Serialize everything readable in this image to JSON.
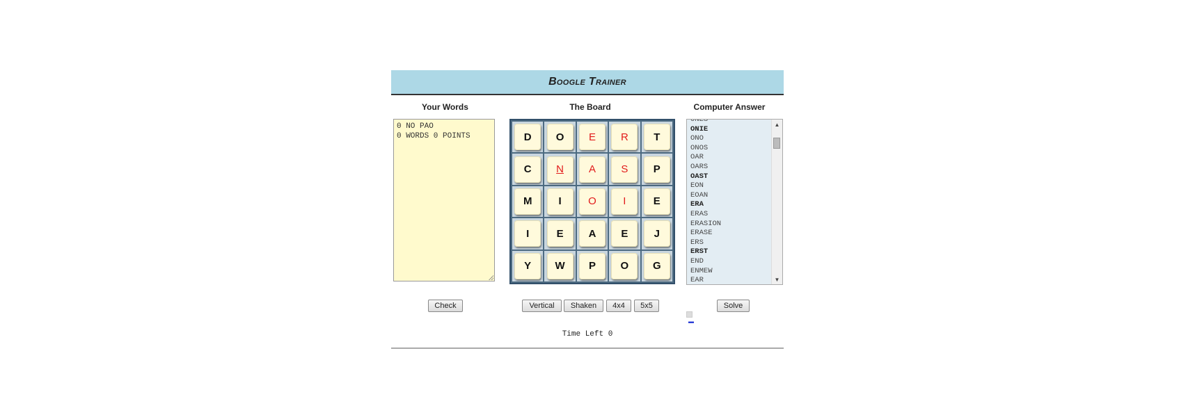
{
  "header": {
    "title": "Boogle Trainer"
  },
  "columns": {
    "your_words": "Your Words",
    "board": "The Board",
    "computer": "Computer Answer"
  },
  "your_words": {
    "lines": [
      "0 NO PAO",
      "0 WORDS 0 POINTS"
    ]
  },
  "board": {
    "size": 5,
    "rows": [
      [
        "D",
        "O",
        "E",
        "R",
        "T"
      ],
      [
        "C",
        "N",
        "A",
        "S",
        "P"
      ],
      [
        "M",
        "I",
        "O",
        "I",
        "E"
      ],
      [
        "I",
        "E",
        "A",
        "E",
        "J"
      ],
      [
        "Y",
        "W",
        "P",
        "O",
        "G"
      ]
    ],
    "highlighted": [
      "0-2",
      "0-3",
      "1-1",
      "1-2",
      "1-3",
      "2-2",
      "2-3"
    ],
    "highlight_color": "#e21b1b"
  },
  "computer_answer": {
    "words": [
      "ONES",
      "ONIE",
      "ONO",
      "ONOS",
      "OAR",
      "OARS",
      "OAST",
      "EON",
      "EOAN",
      "ERA",
      "ERAS",
      "ERASION",
      "ERASE",
      "ERS",
      "ERST",
      "END",
      "ENMEW",
      "EAR"
    ],
    "bold": [
      "ONIE",
      "OAST",
      "ERA",
      "ERST"
    ]
  },
  "buttons": {
    "check": "Check",
    "vertical": "Vertical",
    "shaken": "Shaken",
    "four": "4x4",
    "five": "5x5",
    "solve": "Solve"
  },
  "status": {
    "time_left": "Time Left 0"
  }
}
